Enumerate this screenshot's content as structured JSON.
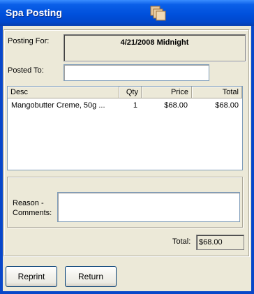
{
  "window": {
    "title": "Spa Posting",
    "icon": "stacked-pages-icon"
  },
  "form": {
    "posting_for_label": "Posting For:",
    "posting_for_value": "4/21/2008 Midnight",
    "posted_to_label": "Posted To:",
    "posted_to_value": ""
  },
  "table": {
    "columns": [
      "Desc",
      "Qty",
      "Price",
      "Total"
    ],
    "rows": [
      {
        "desc": "Mangobutter Creme, 50g ...",
        "qty": "1",
        "price": "$68.00",
        "total": "$68.00"
      }
    ]
  },
  "reason": {
    "label_line1": "Reason -",
    "label_line2": "Comments:",
    "value": ""
  },
  "totals": {
    "label": "Total:",
    "value": "$68.00"
  },
  "buttons": {
    "reprint": "Reprint",
    "return": "Return"
  },
  "colors": {
    "titlebar": "#0050dc",
    "window_bg": "#ece9d8"
  }
}
